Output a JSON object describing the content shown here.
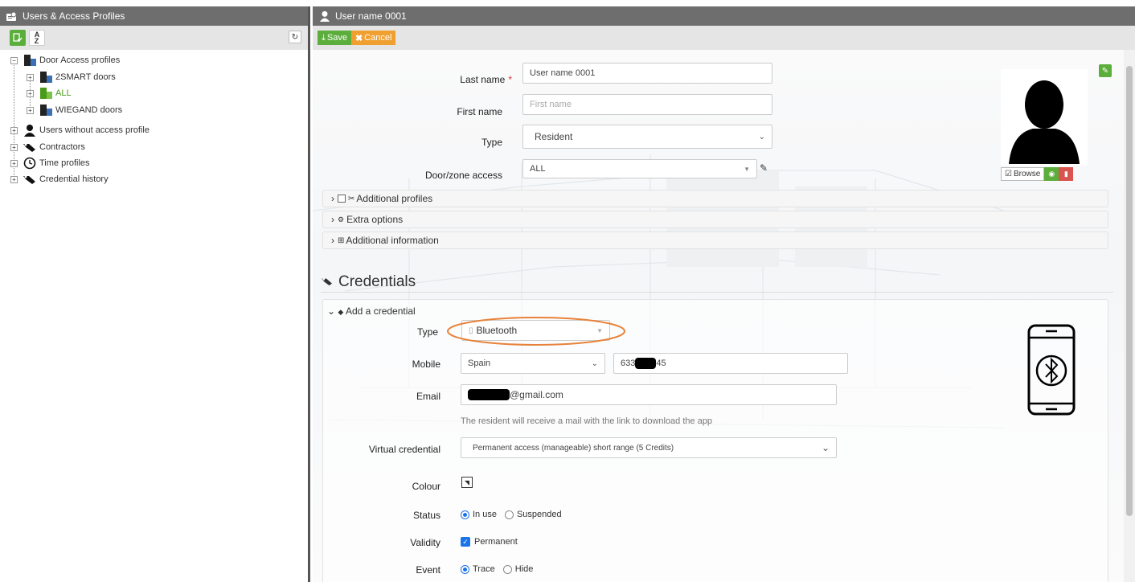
{
  "left_panel": {
    "title": "Users & Access Profiles",
    "tree": [
      {
        "label": "Door Access profiles",
        "expander": "−"
      },
      {
        "label": "2SMART doors",
        "expander": "+"
      },
      {
        "label": "ALL",
        "expander": "+"
      },
      {
        "label": "WIEGAND doors",
        "expander": "+"
      },
      {
        "label": "Users without access profile",
        "expander": "+"
      },
      {
        "label": "Contractors",
        "expander": "+"
      },
      {
        "label": "Time profiles",
        "expander": "+"
      },
      {
        "label": "Credential history",
        "expander": "+"
      }
    ]
  },
  "right_panel": {
    "title": "User name 0001",
    "save_label": "Save",
    "cancel_label": "Cancel"
  },
  "user_form": {
    "last_name_label": "Last name",
    "last_name_required": "*",
    "last_name_value": "User name 0001",
    "first_name_label": "First name",
    "first_name_placeholder": "First name",
    "type_label": "Type",
    "type_value": "Resident",
    "door_zone_label": "Door/zone access",
    "door_zone_value": "ALL"
  },
  "photo": {
    "browse_label": "Browse"
  },
  "sections": {
    "additional_profiles": "Additional profiles",
    "extra_options": "Extra options",
    "additional_information": "Additional information"
  },
  "credentials": {
    "heading": "Credentials",
    "add_credential": "Add a credential",
    "type_label": "Type",
    "type_value": "Bluetooth",
    "mobile_label": "Mobile",
    "mobile_country": "Spain",
    "mobile_prefix": "633",
    "mobile_suffix": "45",
    "email_label": "Email",
    "email_suffix": "@gmail.com",
    "email_hint": "The resident will receive a mail with the link to download the app",
    "virtual_label": "Virtual credential",
    "virtual_value": "Permanent access (manageable) short range (5 Credits)",
    "colour_label": "Colour",
    "status_label": "Status",
    "status_in_use": "In use",
    "status_suspended": "Suspended",
    "validity_label": "Validity",
    "validity_permanent": "Permanent",
    "event_label": "Event",
    "event_trace": "Trace",
    "event_hide": "Hide"
  },
  "colors": {
    "title_bar": "#6e6e6e",
    "accent_green": "#5cae3c",
    "cancel_orange": "#f0a030",
    "highlight_orange": "#e8823a",
    "radio_blue": "#1a73e8"
  }
}
